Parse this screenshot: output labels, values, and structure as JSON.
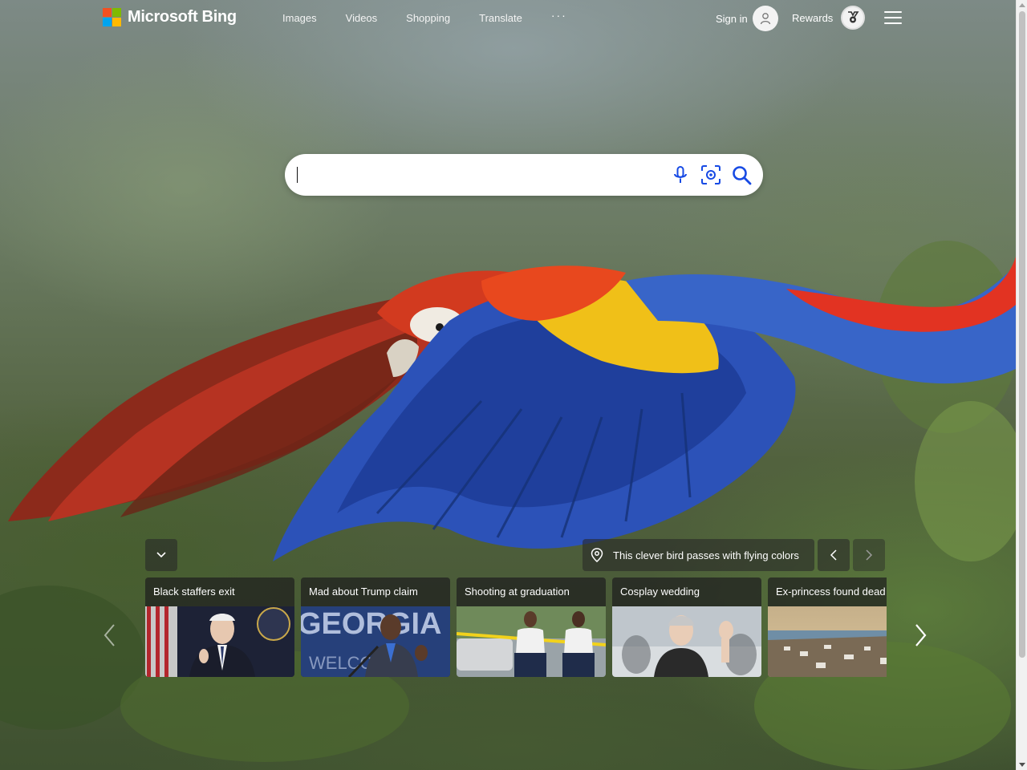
{
  "header": {
    "logo_text": "Microsoft Bing",
    "nav": [
      {
        "label": "Images"
      },
      {
        "label": "Videos"
      },
      {
        "label": "Shopping"
      },
      {
        "label": "Translate"
      }
    ],
    "more_label": "···",
    "signin_label": "Sign in",
    "rewards_label": "Rewards"
  },
  "search": {
    "value": "",
    "placeholder": ""
  },
  "image_info": {
    "text": "This clever bird passes with flying colors"
  },
  "news": [
    {
      "title": "Black staffers exit"
    },
    {
      "title": "Mad about Trump claim"
    },
    {
      "title": "Shooting at graduation"
    },
    {
      "title": "Cosplay wedding"
    },
    {
      "title": "Ex-princess found dead"
    }
  ],
  "colors": {
    "ms_red": "#f25022",
    "ms_green": "#7fba00",
    "ms_blue": "#00a4ef",
    "ms_yellow": "#ffb900",
    "search_icon_blue": "#174ae4"
  },
  "icons": {
    "mic": "microphone-icon",
    "visual_search": "visual-search-icon",
    "search": "search-icon",
    "location": "location-pin-icon",
    "menu": "hamburger-icon"
  }
}
